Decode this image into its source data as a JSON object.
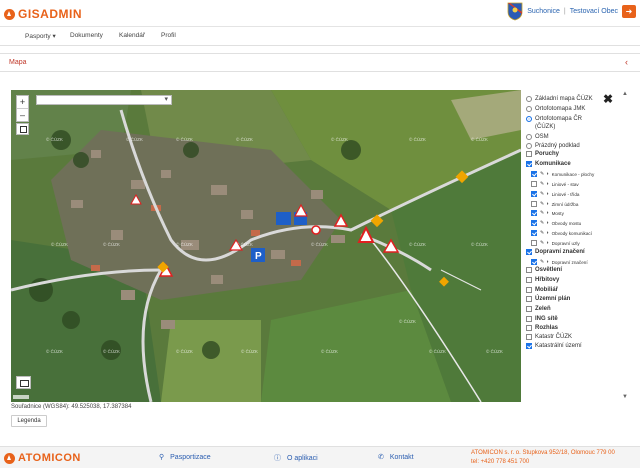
{
  "header": {
    "brand": "GISADMIN",
    "user_org": "Suchonice",
    "separator": "|",
    "user_name": "Testovací Obec",
    "logout_icon": "logout-icon"
  },
  "nav": {
    "items": [
      "Pasporty ▾",
      "Dokumenty",
      "Kalendář",
      "Profil"
    ]
  },
  "panel": {
    "title": "Mapa",
    "collapse_icon": "‹"
  },
  "map": {
    "select_value": "",
    "zoom_in": "+",
    "zoom_out": "–",
    "watermark": "© ČÚZK",
    "close_icon": "✖"
  },
  "layers": {
    "base": [
      {
        "label": "Základní mapa ČÚZK",
        "selected": false
      },
      {
        "label": "Ortofotomapa JMK",
        "selected": false
      },
      {
        "label": "Ortofotomapa ČR",
        "selected": true
      },
      {
        "label": "(ČÚZK)",
        "selected": false
      },
      {
        "label": "OSM",
        "selected": false
      },
      {
        "label": "Prázdný podklad",
        "selected": false
      }
    ],
    "overlay": [
      {
        "label": "Poruchy",
        "checked": false,
        "bold": true
      },
      {
        "label": "Komunikace",
        "checked": true,
        "bold": true
      },
      {
        "label": "Komunikace - plochy",
        "checked": true,
        "sub": true
      },
      {
        "label": "Liniové - stav",
        "checked": false,
        "sub": true
      },
      {
        "label": "Liniové - třída",
        "checked": true,
        "sub": true
      },
      {
        "label": "Zimní údržba",
        "checked": false,
        "sub": true
      },
      {
        "label": "Mosty",
        "checked": true,
        "sub": true
      },
      {
        "label": "Obvody mostu",
        "checked": true,
        "sub": true
      },
      {
        "label": "Obvody komunikací",
        "checked": true,
        "sub": true
      },
      {
        "label": "Dopravní uzly",
        "checked": false,
        "sub": true
      },
      {
        "label": "Dopravní značení",
        "checked": true,
        "bold": true
      },
      {
        "label": "Dopravní značení",
        "checked": true,
        "sub": true
      },
      {
        "label": "Osvětlení",
        "checked": false,
        "bold": true
      },
      {
        "label": "Hřbitovy",
        "checked": false,
        "bold": true
      },
      {
        "label": "Mobiliář",
        "checked": false,
        "bold": true
      },
      {
        "label": "Územní plán",
        "checked": false,
        "bold": true
      },
      {
        "label": "Zeleň",
        "checked": false,
        "bold": true
      },
      {
        "label": "ING sítě",
        "checked": false,
        "bold": true
      },
      {
        "label": "Rozhlas",
        "checked": false,
        "bold": true
      },
      {
        "label": "Katastr ČÚZK",
        "checked": false,
        "bold": false
      },
      {
        "label": "Katastrální území",
        "checked": true,
        "bold": false
      }
    ]
  },
  "coords": "Souřadnice (WGS84): 49.525038, 17.387384",
  "legend_button": "Legenda",
  "footer": {
    "brand": "ATOMICON",
    "link1": "Pasportizace",
    "link2": "O aplikaci",
    "link3": "Kontakt",
    "address_line1": "ATOMICON s. r. o. Stupkova 952/18, Olomouc 779 00",
    "address_line2": "tel: +420 778 451 700"
  },
  "colors": {
    "brand": "#e8621a",
    "link": "#2a64b0",
    "accent": "#1a73e8"
  }
}
